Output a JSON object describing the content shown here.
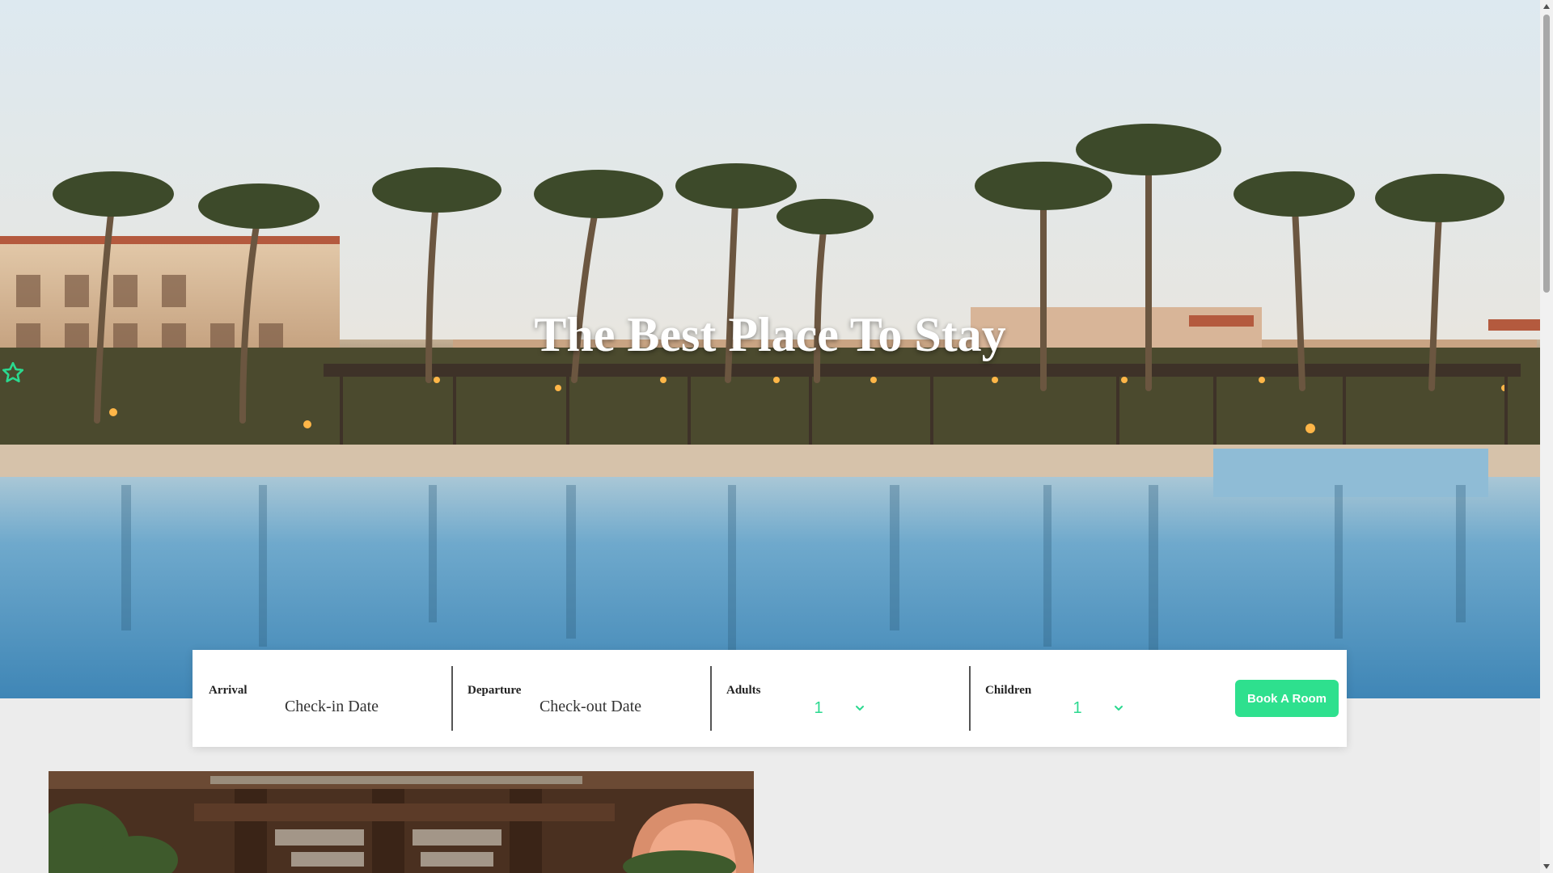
{
  "hero": {
    "title": "The Best Place To Stay",
    "rating": {
      "stars": 5,
      "filled": 0
    },
    "accent_color": "#2bd98f"
  },
  "booking": {
    "arrival": {
      "label": "Arrival",
      "placeholder": "Check-in Date"
    },
    "departure": {
      "label": "Departure",
      "placeholder": "Check-out Date"
    },
    "adults": {
      "label": "Adults",
      "value": "1"
    },
    "children": {
      "label": "Children",
      "value": "1"
    },
    "submit_label": "Book A Room",
    "button_color": "#2ee08e"
  },
  "icons": {
    "star": "star-outline-icon",
    "dropdown": "chevron-down-icon"
  }
}
